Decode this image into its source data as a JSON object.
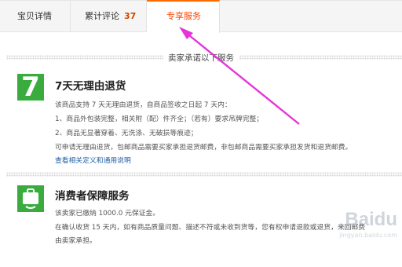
{
  "tabs": [
    {
      "label": "宝贝详情"
    },
    {
      "label": "累计评论",
      "count": "37"
    },
    {
      "label": "专享服务"
    }
  ],
  "section_title": "卖家承诺以下服务",
  "return_service": {
    "badge": "7",
    "title": "7天无理由退货",
    "lines": [
      "该商品支持 7 天无理由退货，自商品签收之日起 7 天内：",
      "1、商品外包装完整，相关附（配）件齐全；（若有）要求吊牌完整；",
      "2、商品无显著穿着、无洗涤、无破损等痕迹；",
      "可申请无理由退货，包邮商品需要买家承担退货邮费，非包邮商品需要买家承担发货和退货邮费。"
    ],
    "link": "查看相关定义和通用说明"
  },
  "protection": {
    "title": "消费者保障服务",
    "lines": [
      "该卖家已缴纳 1000.0 元保证金。",
      "在确认收货 15 天内，如有商品质量问题、描述不符或未收到货等，您有权申请退款或退货，来回邮费",
      "由卖家承担。"
    ]
  },
  "watermark": {
    "brand": "Baidu",
    "sub": "jingyan.baidu.com"
  },
  "colors": {
    "accent": "#ff6a00",
    "badge_green": "#3aab3f",
    "arrow": "#e535d8",
    "link": "#1f5fa6"
  }
}
